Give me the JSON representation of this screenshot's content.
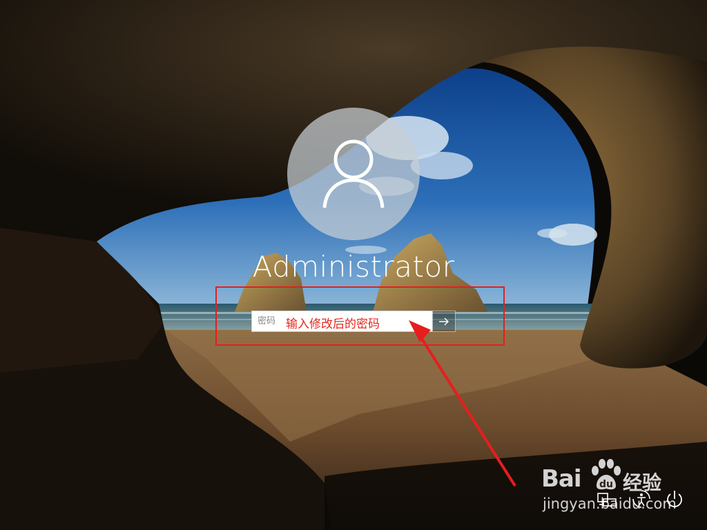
{
  "user": {
    "name": "Administrator",
    "avatar_icon": "user-silhouette-icon"
  },
  "password": {
    "placeholder": "密码",
    "value": "",
    "submit_icon": "arrow-right-icon"
  },
  "annotation": {
    "text": "输入修改后的密码",
    "color": "#e8261d"
  },
  "system_buttons": {
    "network_icon": "network-icon",
    "ease_of_access_icon": "ease-of-access-icon",
    "power_icon": "power-icon"
  },
  "watermark": {
    "brand": "Bai",
    "brand_cn": "经验",
    "url": "jingyan.baidu.com"
  },
  "colors": {
    "annotation_red": "#e61e1e",
    "text_white": "#ffffff"
  }
}
